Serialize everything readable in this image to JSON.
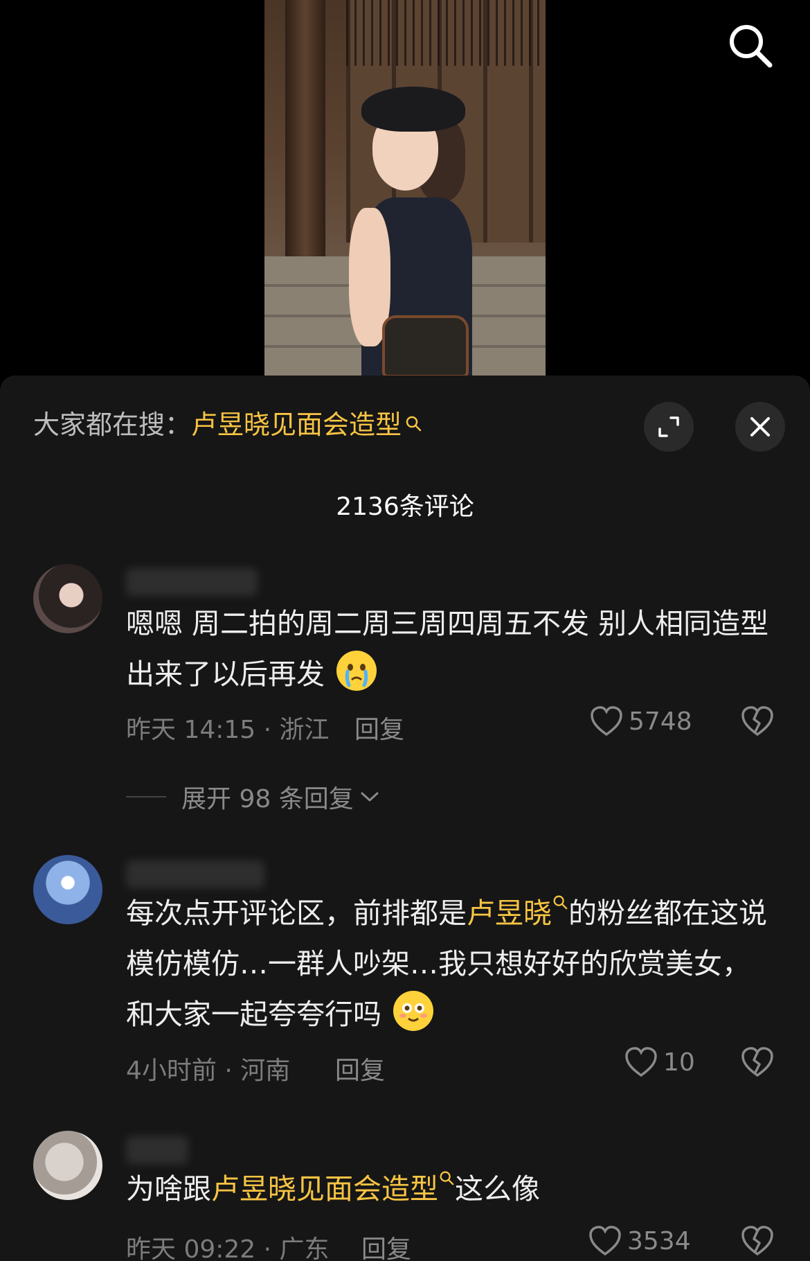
{
  "header": {
    "search_icon": "search-icon"
  },
  "sheet": {
    "search_hint_prefix": "大家都在搜：",
    "search_hint_keyword": "卢昱晓见面会造型",
    "comment_count_title": "2136条评论",
    "expand_icon": "expand-icon",
    "close_icon": "close-icon"
  },
  "comments": [
    {
      "text": "嗯嗯 周二拍的周二周三周四周五不发 别人相同造型出来了以后再发",
      "emoji": "crying-emoji",
      "time_location": "昨天 14:15 · 浙江",
      "reply_label": "回复",
      "likes": "5748",
      "expand_replies": "展开 98 条回复"
    },
    {
      "text_before": "每次点开评论区，前排都是",
      "keyword": "卢昱晓",
      "text_after": "的粉丝都在这说模仿模仿…一群人吵架…我只想好好的欣赏美女，和大家一起夸夸行吗",
      "emoji": "smiling-emoji",
      "time_location": "4小时前 · 河南",
      "reply_label": "回复",
      "likes": "10"
    },
    {
      "text_before": "为啥跟",
      "keyword": "卢昱晓见面会造型",
      "text_after": "这么像",
      "time_location": "昨天 09:22 · 广东",
      "reply_label": "回复",
      "likes": "3534"
    }
  ],
  "colors": {
    "keyword": "#f8c443",
    "sheet_bg": "#161616",
    "muted_text": "#7c7c7c"
  }
}
